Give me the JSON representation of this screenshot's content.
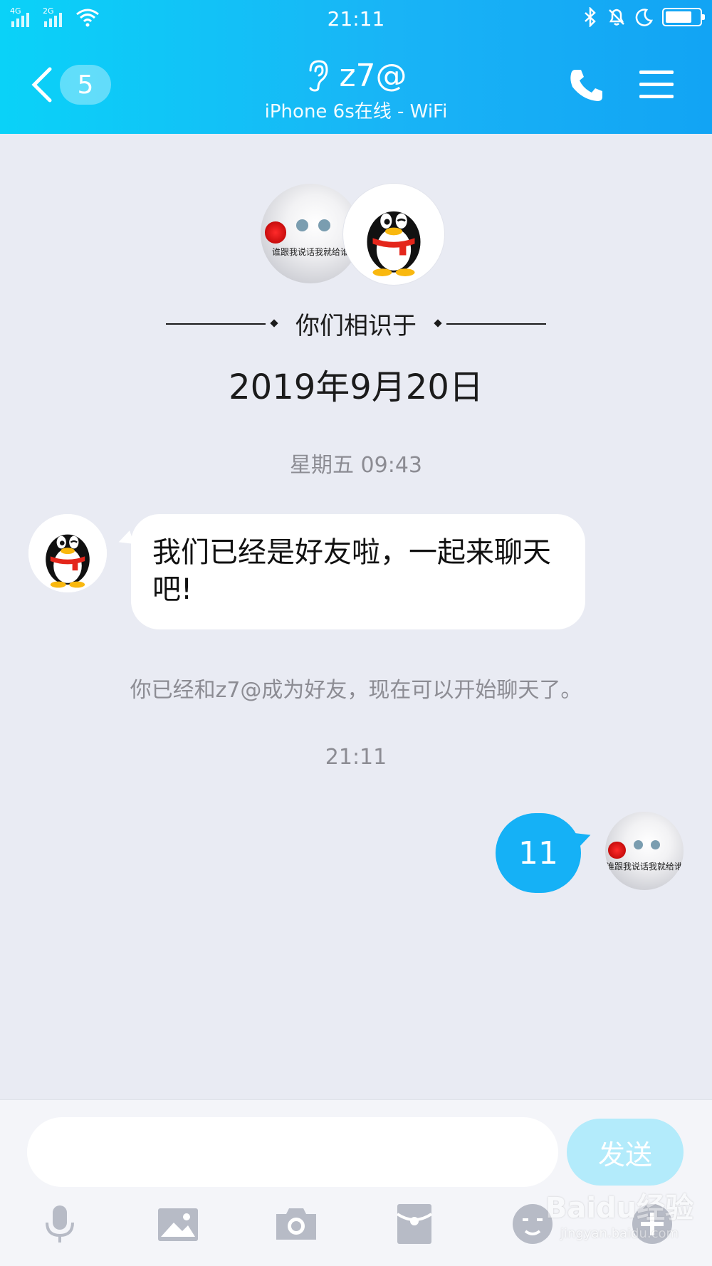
{
  "status_bar": {
    "network_1": "4G",
    "network_2": "2G",
    "time": "21:11",
    "battery_level": 0.78
  },
  "header": {
    "unread_count": "5",
    "contact_name": "z7@",
    "contact_status": "iPhone 6s在线 - WiFi"
  },
  "chat": {
    "met_label": "你们相识于",
    "met_date": "2019年9月20日",
    "timestamp_1": "星期五 09:43",
    "incoming_message": "我们已经是好友啦，一起来聊天吧!",
    "system_notice": "你已经和z7@成为好友，现在可以开始聊天了。",
    "timestamp_2": "21:11",
    "outgoing_message": "11",
    "avatar_caption": "谁跟我说话我就给谁"
  },
  "input": {
    "value": "",
    "placeholder": "",
    "send_label": "发送"
  },
  "toolbar": {
    "icons": [
      "microphone-icon",
      "image-icon",
      "camera-icon",
      "red-packet-icon",
      "emoji-icon",
      "plus-icon"
    ]
  },
  "watermark": {
    "brand": "Baidu经验",
    "url": "jingyan.baidu.com"
  },
  "colors": {
    "header_start": "#0ad2f8",
    "header_end": "#12a4f4",
    "chat_bg": "#e9ebf3",
    "outgoing_bubble": "#15b1f6",
    "send_button": "#b3ebfb"
  }
}
